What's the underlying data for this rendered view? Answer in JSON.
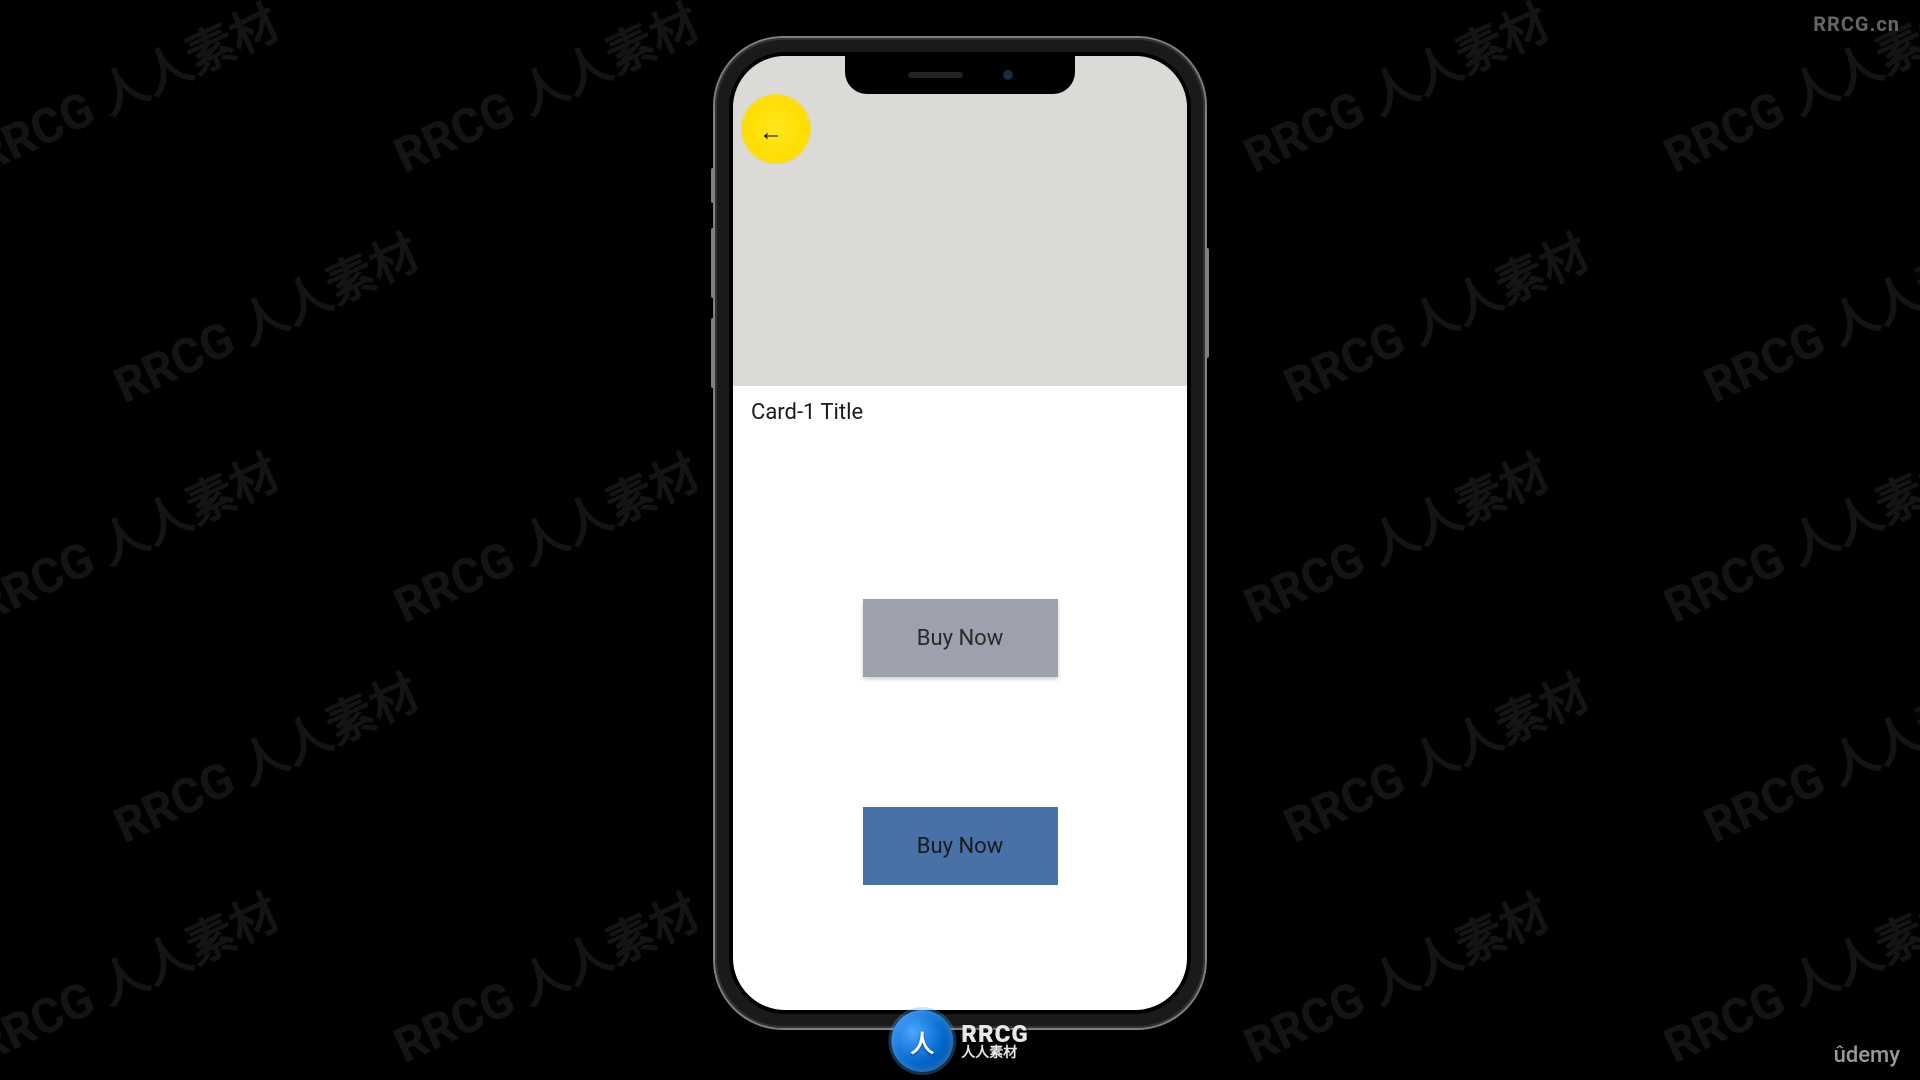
{
  "watermarks": {
    "corner": "RRCG.cn",
    "repeated": "RRCG 人人素材",
    "bottom_provider": "ûdemy"
  },
  "bottom_logo": {
    "badge": "人",
    "main": "RRCG",
    "sub": "人人素材"
  },
  "app": {
    "card_title": "Card-1 Title",
    "buttons": {
      "buy_1": "Buy Now",
      "buy_2": "Buy Now"
    },
    "back_arrow": "←"
  }
}
